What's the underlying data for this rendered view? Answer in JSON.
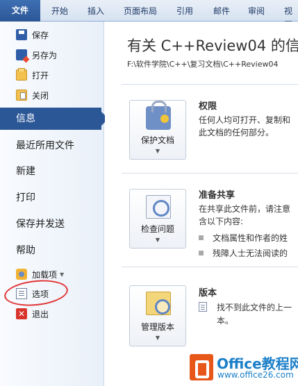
{
  "ribbon": {
    "tabs": [
      "文件",
      "开始",
      "插入",
      "页面布局",
      "引用",
      "邮件",
      "审阅",
      "视图"
    ]
  },
  "nav": {
    "save": "保存",
    "save_as": "另存为",
    "open": "打开",
    "close": "关闭",
    "info": "信息",
    "recent": "最近所用文件",
    "new": "新建",
    "print": "打印",
    "save_send": "保存并发送",
    "help": "帮助",
    "addins": "加载项",
    "options": "选项",
    "exit": "退出"
  },
  "document": {
    "title": "有关 C++Review04 的信",
    "path": "F:\\软件学院\\C++\\复习文档\\C++Review04"
  },
  "sections": {
    "permissions": {
      "button": "保护文档",
      "title": "权限",
      "lines": [
        "任何人均可打开、复制和",
        "此文档的任何部分。"
      ]
    },
    "prepare": {
      "button": "检查问题",
      "title": "准备共享",
      "lines": [
        "在共享此文件前，请注意",
        "含以下内容:"
      ],
      "bullets": [
        "文档属性和作者的姓",
        "残障人士无法阅读的"
      ]
    },
    "versions": {
      "button": "管理版本",
      "title": "版本",
      "lines": [
        "找不到此文件的上一",
        "本。"
      ]
    }
  },
  "watermark": {
    "name": "Office教程网",
    "url": "www.office26.com"
  },
  "colors": {
    "accent": "#2b5797",
    "annotation": "#e23232"
  }
}
